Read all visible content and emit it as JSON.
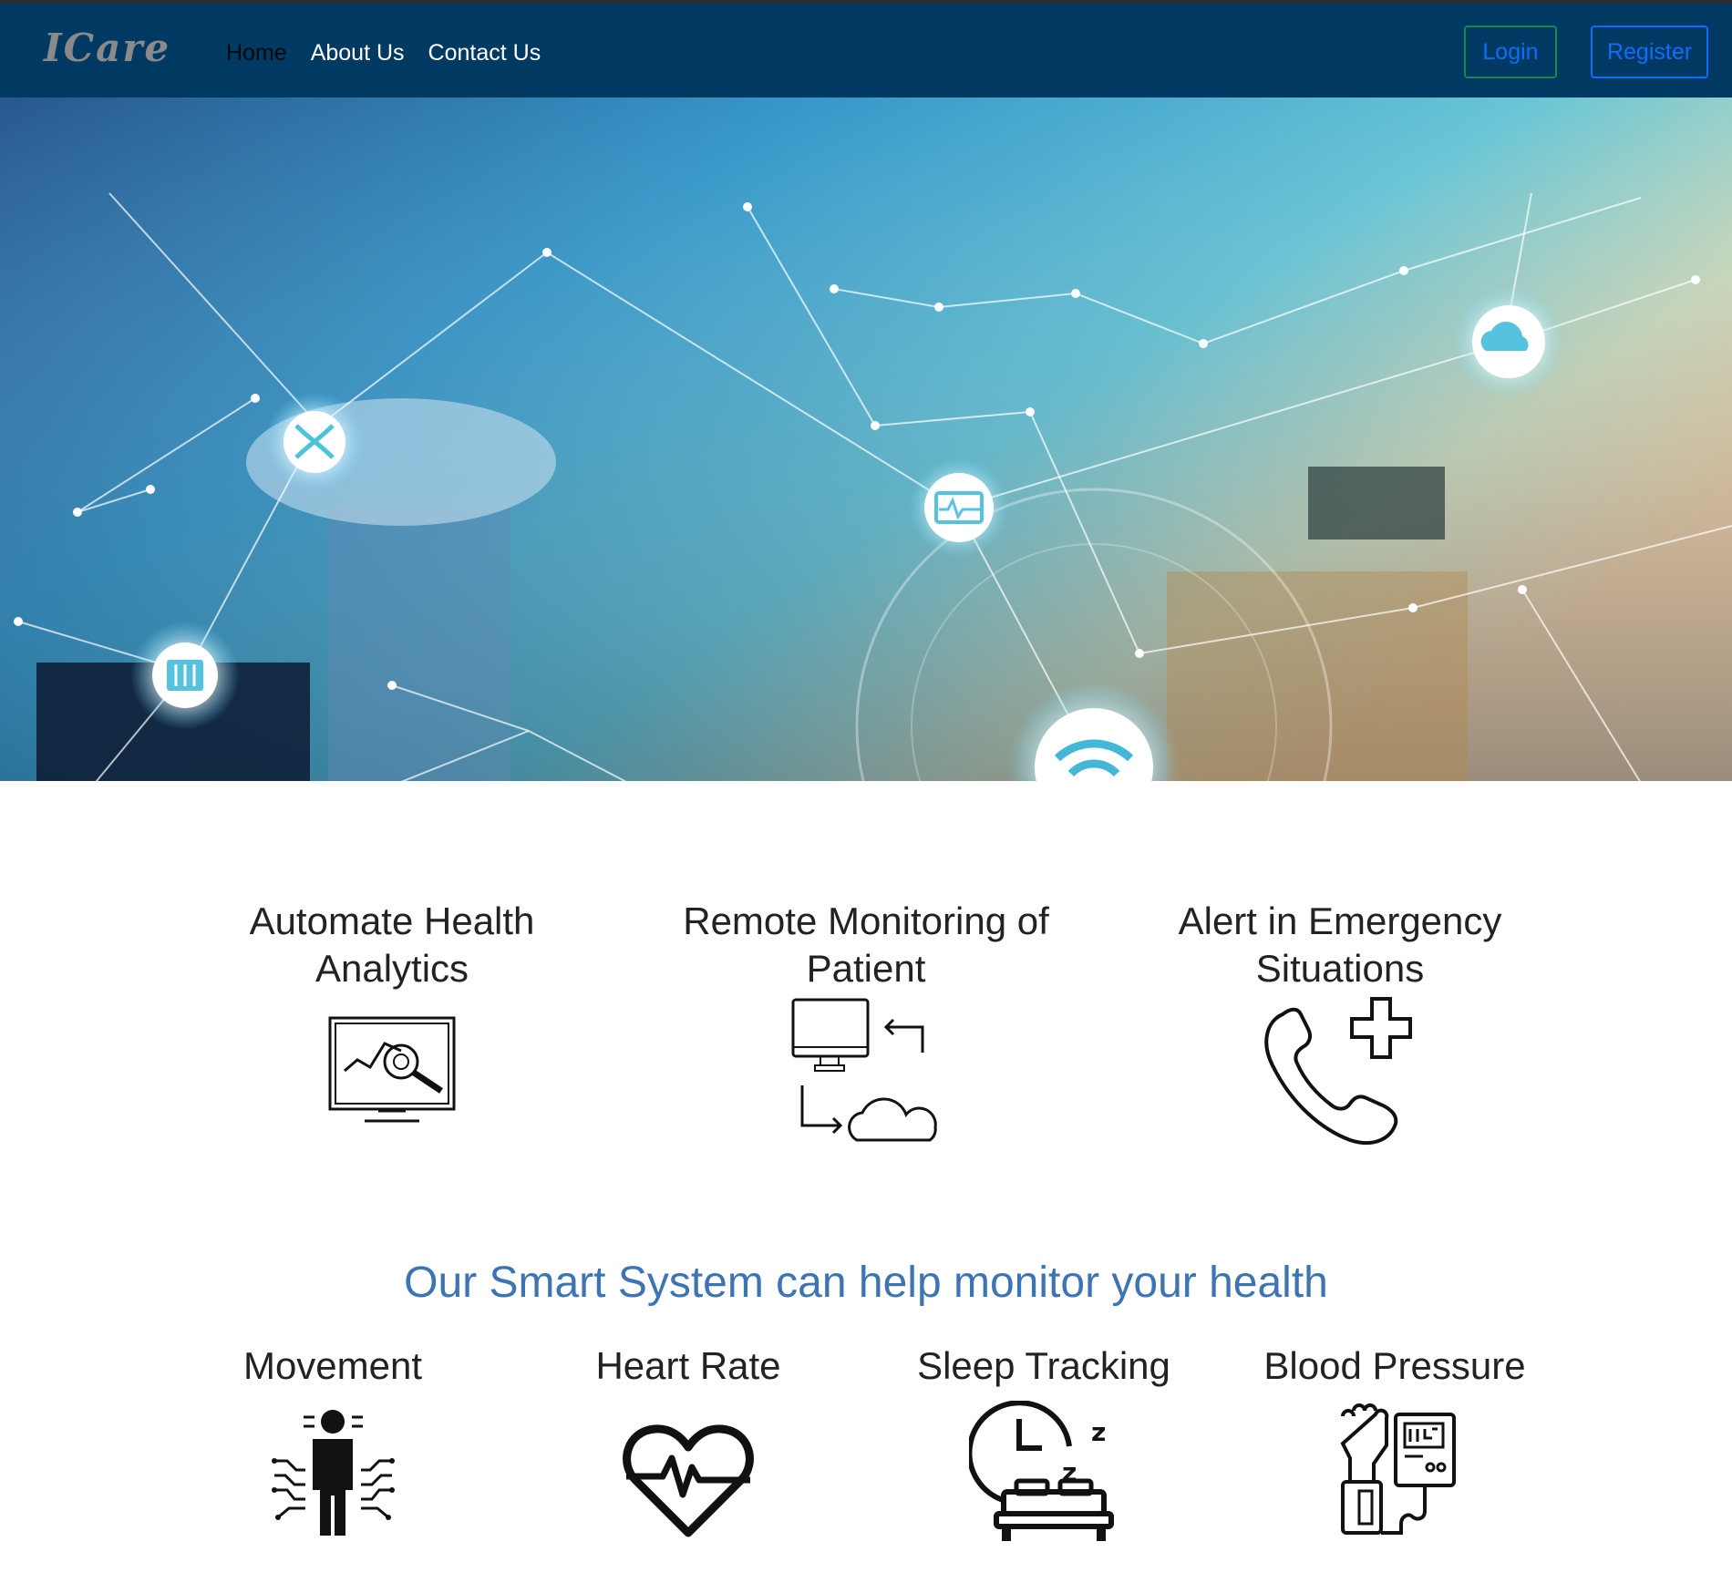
{
  "brand": {
    "name": "ICare"
  },
  "nav": {
    "links": [
      {
        "label": "Home",
        "active": true
      },
      {
        "label": "About Us",
        "active": false
      },
      {
        "label": "Contact Us",
        "active": false
      }
    ],
    "login_label": "Login",
    "register_label": "Register"
  },
  "hero": {
    "carousel_indicators": 4,
    "active_slide": 1,
    "icons": [
      "dna-icon",
      "cloud-icon",
      "monitor-icon",
      "xray-icon",
      "wifi-icon",
      "person-icon"
    ]
  },
  "features": [
    {
      "title_line1": "Automate Health",
      "title_line2": "Analytics",
      "icon": "analytics-monitor-icon"
    },
    {
      "title_line1": "Remote Monitoring of",
      "title_line2": "Patient",
      "icon": "remote-sync-icon"
    },
    {
      "title_line1": "Alert in Emergency",
      "title_line2": "Situations",
      "icon": "emergency-phone-icon"
    }
  ],
  "section": {
    "headline": "Our Smart System can help monitor your health"
  },
  "metrics": [
    {
      "label": "Movement",
      "icon": "body-movement-icon"
    },
    {
      "label": "Heart Rate",
      "icon": "heart-rate-icon"
    },
    {
      "label": "Sleep Tracking",
      "icon": "sleep-tracking-icon"
    },
    {
      "label": "Blood Pressure",
      "icon": "blood-pressure-icon"
    }
  ],
  "colors": {
    "navbar": "#003a63",
    "headline": "#3d74b4",
    "login_border": "#198754",
    "register_border": "#0d6efd"
  }
}
